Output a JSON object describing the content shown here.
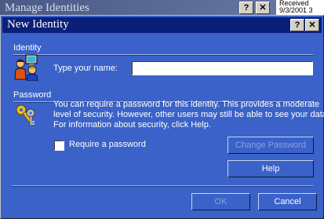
{
  "background_window": {
    "title": "Manage Identities",
    "help_button": "?",
    "close_button": "✕",
    "strip": [
      "Received",
      "9/3/2001 3"
    ]
  },
  "dialog": {
    "title": "New Identity",
    "help_button": "?",
    "close_button": "✕",
    "identity": {
      "section_label": "Identity",
      "name_label": "Type your name:",
      "name_value": ""
    },
    "password": {
      "section_label": "Password",
      "description_line1": "You can require a password for this identity.  This provides a moderate",
      "description_line2": "level of security. However, other users may still be able to see your data.",
      "description_line3": "For information about security, click Help.",
      "require_label": "Require a password",
      "require_checked": false,
      "change_password_button": "Change Password",
      "help_button": "Help"
    },
    "ok_button": "OK",
    "cancel_button": "Cancel"
  },
  "colors": {
    "dialog_bg": "#3a62c8",
    "titlebar_bg": "#0a1f7a",
    "text": "#ffffff"
  }
}
